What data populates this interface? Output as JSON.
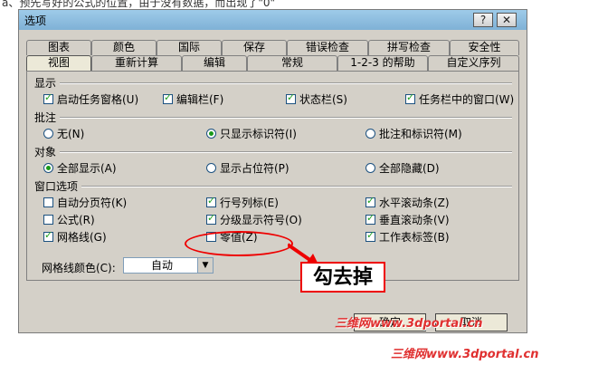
{
  "doc": {
    "top_text": "a、预先写好的公式的位置，由于没有数据，而出现了\"0\"",
    "bottom_text": ""
  },
  "dialog": {
    "title": "选项",
    "help_button": "?",
    "close_button": "✕"
  },
  "tabs": {
    "row1": [
      "图表",
      "颜色",
      "国际",
      "保存",
      "错误检查",
      "拼写检查",
      "安全性"
    ],
    "row2": [
      "视图",
      "重新计算",
      "编辑",
      "常规",
      "1-2-3 的帮助",
      "自定义序列"
    ],
    "active": "视图"
  },
  "groups": {
    "display": {
      "title": "显示",
      "items": [
        {
          "label": "启动任务窗格(U)",
          "checked": true
        },
        {
          "label": "编辑栏(F)",
          "checked": true
        },
        {
          "label": "状态栏(S)",
          "checked": true
        },
        {
          "label": "任务栏中的窗口(W)",
          "checked": true
        }
      ]
    },
    "comments": {
      "title": "批注",
      "items": [
        {
          "label": "无(N)",
          "selected": false
        },
        {
          "label": "只显示标识符(I)",
          "selected": true
        },
        {
          "label": "批注和标识符(M)",
          "selected": false
        }
      ]
    },
    "objects": {
      "title": "对象",
      "items": [
        {
          "label": "全部显示(A)",
          "selected": true
        },
        {
          "label": "显示占位符(P)",
          "selected": false
        },
        {
          "label": "全部隐藏(D)",
          "selected": false
        }
      ]
    },
    "window": {
      "title": "窗口选项",
      "items": [
        {
          "label": "自动分页符(K)",
          "checked": false
        },
        {
          "label": "行号列标(E)",
          "checked": true
        },
        {
          "label": "水平滚动条(Z)",
          "checked": true
        },
        {
          "label": "公式(R)",
          "checked": false
        },
        {
          "label": "分级显示符号(O)",
          "checked": true
        },
        {
          "label": "垂直滚动条(V)",
          "checked": true
        },
        {
          "label": "网格线(G)",
          "checked": true
        },
        {
          "label": "零值(Z)",
          "checked": false
        },
        {
          "label": "工作表标签(B)",
          "checked": true
        }
      ]
    }
  },
  "gridline_color": {
    "label": "网格线颜色(C):",
    "value": "自动"
  },
  "annotation": {
    "text": "勾去掉",
    "color": "#e00000"
  },
  "footer": {
    "ok": "确定",
    "cancel": "取消"
  },
  "watermarks": {
    "wm1": "三维网www.3dportal.cn",
    "wm2": "三维网www.3dportal.cn"
  }
}
